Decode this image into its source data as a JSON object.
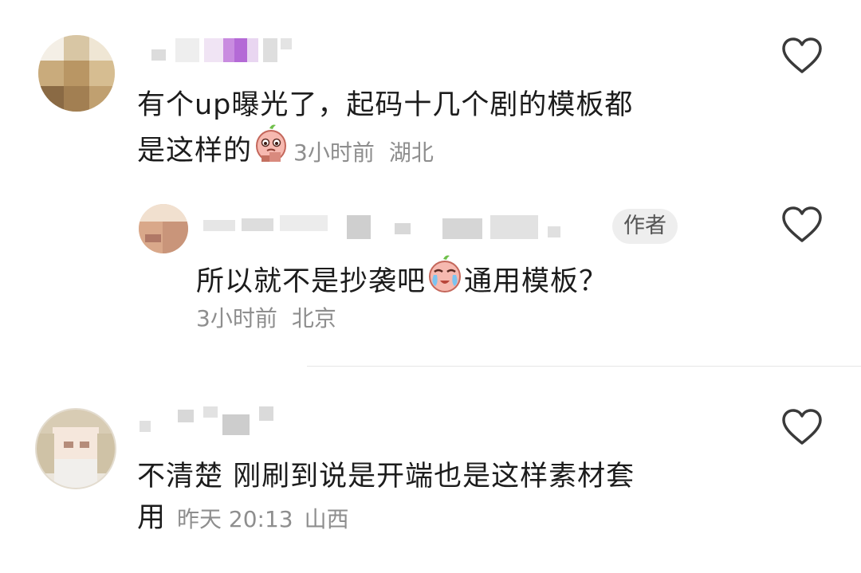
{
  "comments": [
    {
      "text_line1": "有个up曝光了，起码十几个剧的模板都",
      "text_line2": "是这样的",
      "time": "3小时前",
      "location": "湖北"
    },
    {
      "badge": "作者",
      "text": "所以就不是抄袭吧",
      "text_after": "通用模板？",
      "time": "3小时前",
      "location": "北京"
    },
    {
      "text_line1": "不清楚 刚刷到说是开端也是这样素材套",
      "text_line2": "用",
      "time": "昨天 20:13",
      "location": "山西"
    }
  ],
  "icons": {
    "like": "heart-outline-icon",
    "emoji_think": "thinking-emoji-icon",
    "emoji_cry": "crying-emoji-icon"
  },
  "colors": {
    "meta_text": "#8e8e8e",
    "heart_stroke": "#3a3a3a",
    "badge_bg": "#eeeeee"
  }
}
